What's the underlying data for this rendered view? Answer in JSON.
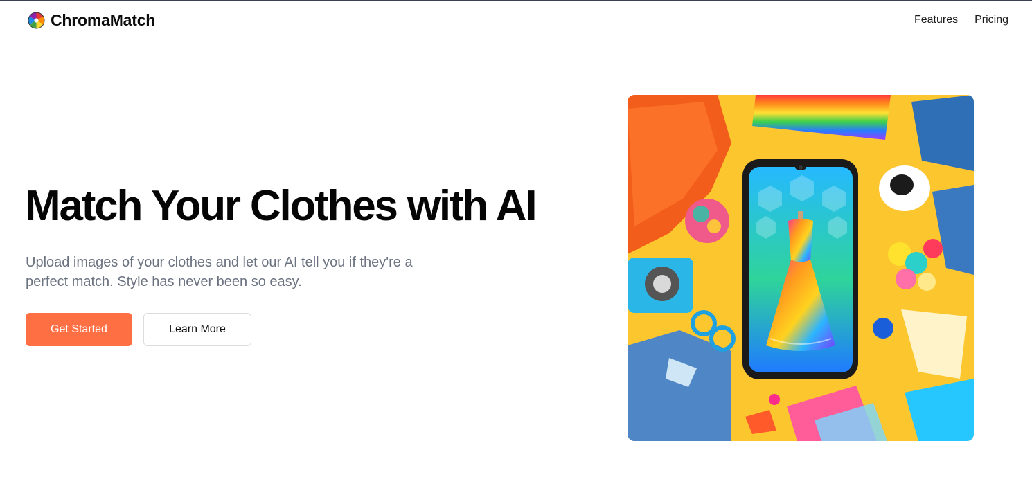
{
  "brand": {
    "name": "ChromaMatch",
    "logo_icon": "color-wheel-icon"
  },
  "nav": {
    "links": [
      "Features",
      "Pricing"
    ]
  },
  "hero": {
    "title": "Match Your Clothes with AI",
    "subtitle": "Upload images of your clothes and let our AI tell you if they're a perfect match. Style has never been so easy.",
    "primary_button": "Get Started",
    "secondary_button": "Learn More",
    "image_icon": "phone-with-rainbow-dress-illustration"
  },
  "colors": {
    "accent": "#ff6f44",
    "subtitle_text": "#6b7280",
    "image_background": "#fcc62f"
  }
}
